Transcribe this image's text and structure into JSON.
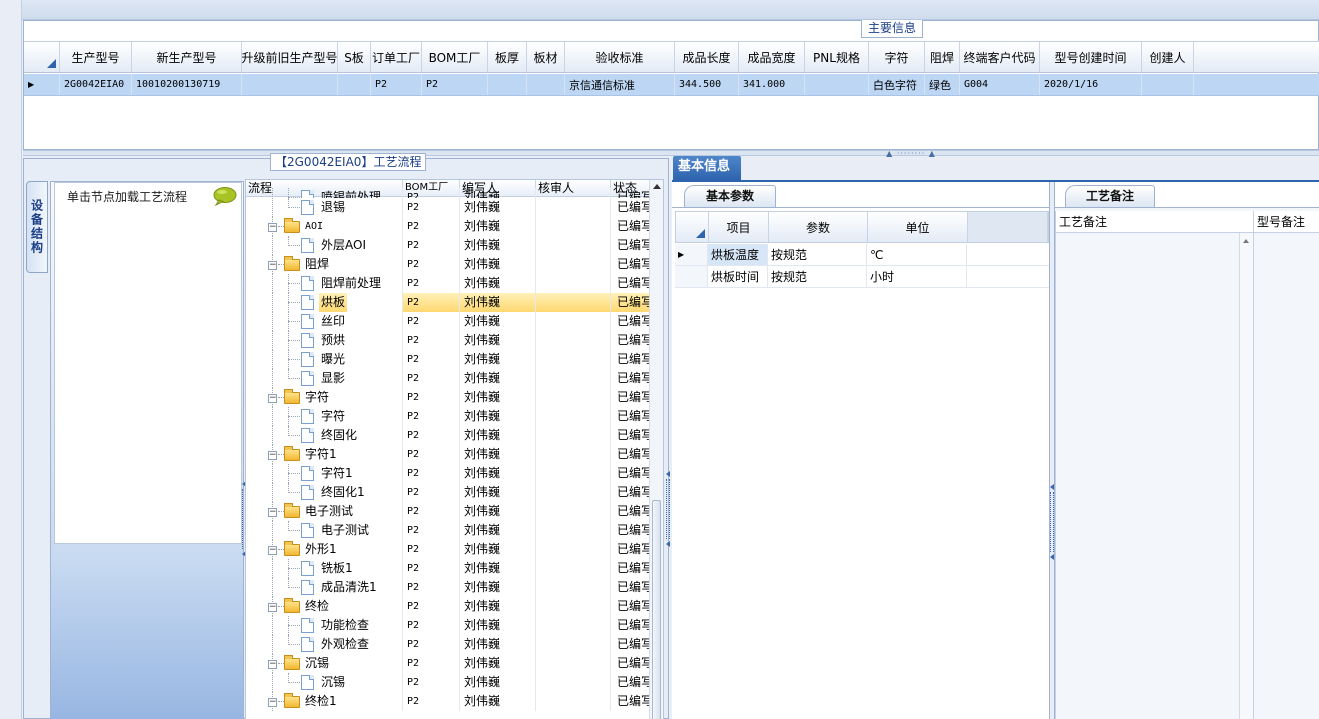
{
  "main_info": {
    "caption": "主要信息",
    "columns": [
      "生产型号",
      "新生产型号",
      "升级前旧生产型号",
      "S板",
      "订单工厂",
      "BOM工厂",
      "板厚",
      "板材",
      "验收标准",
      "成品长度",
      "成品宽度",
      "PNL规格",
      "字符",
      "阻焊",
      "终端客户代码",
      "型号创建时间",
      "创建人"
    ],
    "row": [
      "2G0042EIA0",
      "10010200130719",
      "",
      "",
      "P2",
      "P2",
      "",
      "",
      "京信通信标准",
      "344.500",
      "341.000",
      "",
      "白色字符",
      "绿色",
      "G004",
      "2020/1/16",
      ""
    ]
  },
  "left_panel": {
    "side_tab": "设备结构",
    "nav_title": "单击节点加载工艺流程",
    "nav_icon": "speech-bubble-icon"
  },
  "tree": {
    "caption": "【2G0042EIA0】工艺流程",
    "columns": [
      "流程",
      "BOM工厂",
      "编写人",
      "核审人",
      "状态"
    ],
    "rows": [
      {
        "level": 2,
        "kind": "file",
        "name": "喷锡前处理",
        "bom": "P2",
        "writer": "刘伟巍",
        "reviewer": "",
        "status": "已编写",
        "partial": true
      },
      {
        "level": 2,
        "kind": "file",
        "name": "退锡",
        "bom": "P2",
        "writer": "刘伟巍",
        "reviewer": "",
        "status": "已编写",
        "last": true
      },
      {
        "level": 1,
        "kind": "folder",
        "name": "AOI",
        "bom": "P2",
        "writer": "刘伟巍",
        "reviewer": "",
        "status": "已编写"
      },
      {
        "level": 2,
        "kind": "file",
        "name": "外层AOI",
        "bom": "P2",
        "writer": "刘伟巍",
        "reviewer": "",
        "status": "已编写",
        "last": true
      },
      {
        "level": 1,
        "kind": "folder",
        "name": "阻焊",
        "bom": "P2",
        "writer": "刘伟巍",
        "reviewer": "",
        "status": "已编写"
      },
      {
        "level": 2,
        "kind": "file",
        "name": "阻焊前处理",
        "bom": "P2",
        "writer": "刘伟巍",
        "reviewer": "",
        "status": "已编写"
      },
      {
        "level": 2,
        "kind": "file",
        "name": "烘板",
        "bom": "P2",
        "writer": "刘伟巍",
        "reviewer": "",
        "status": "已编写",
        "selected": true
      },
      {
        "level": 2,
        "kind": "file",
        "name": "丝印",
        "bom": "P2",
        "writer": "刘伟巍",
        "reviewer": "",
        "status": "已编写"
      },
      {
        "level": 2,
        "kind": "file",
        "name": "预烘",
        "bom": "P2",
        "writer": "刘伟巍",
        "reviewer": "",
        "status": "已编写"
      },
      {
        "level": 2,
        "kind": "file",
        "name": "曝光",
        "bom": "P2",
        "writer": "刘伟巍",
        "reviewer": "",
        "status": "已编写"
      },
      {
        "level": 2,
        "kind": "file",
        "name": "显影",
        "bom": "P2",
        "writer": "刘伟巍",
        "reviewer": "",
        "status": "已编写",
        "last": true
      },
      {
        "level": 1,
        "kind": "folder",
        "name": "字符",
        "bom": "P2",
        "writer": "刘伟巍",
        "reviewer": "",
        "status": "已编写"
      },
      {
        "level": 2,
        "kind": "file",
        "name": "字符",
        "bom": "P2",
        "writer": "刘伟巍",
        "reviewer": "",
        "status": "已编写"
      },
      {
        "level": 2,
        "kind": "file",
        "name": "终固化",
        "bom": "P2",
        "writer": "刘伟巍",
        "reviewer": "",
        "status": "已编写",
        "last": true
      },
      {
        "level": 1,
        "kind": "folder",
        "name": "字符1",
        "bom": "P2",
        "writer": "刘伟巍",
        "reviewer": "",
        "status": "已编写"
      },
      {
        "level": 2,
        "kind": "file",
        "name": "字符1",
        "bom": "P2",
        "writer": "刘伟巍",
        "reviewer": "",
        "status": "已编写"
      },
      {
        "level": 2,
        "kind": "file",
        "name": "终固化1",
        "bom": "P2",
        "writer": "刘伟巍",
        "reviewer": "",
        "status": "已编写",
        "last": true
      },
      {
        "level": 1,
        "kind": "folder",
        "name": "电子测试",
        "bom": "P2",
        "writer": "刘伟巍",
        "reviewer": "",
        "status": "已编写"
      },
      {
        "level": 2,
        "kind": "file",
        "name": "电子测试",
        "bom": "P2",
        "writer": "刘伟巍",
        "reviewer": "",
        "status": "已编写",
        "last": true
      },
      {
        "level": 1,
        "kind": "folder",
        "name": "外形1",
        "bom": "P2",
        "writer": "刘伟巍",
        "reviewer": "",
        "status": "已编写"
      },
      {
        "level": 2,
        "kind": "file",
        "name": "铣板1",
        "bom": "P2",
        "writer": "刘伟巍",
        "reviewer": "",
        "status": "已编写"
      },
      {
        "level": 2,
        "kind": "file",
        "name": "成品清洗1",
        "bom": "P2",
        "writer": "刘伟巍",
        "reviewer": "",
        "status": "已编写",
        "last": true
      },
      {
        "level": 1,
        "kind": "folder",
        "name": "终检",
        "bom": "P2",
        "writer": "刘伟巍",
        "reviewer": "",
        "status": "已编写"
      },
      {
        "level": 2,
        "kind": "file",
        "name": "功能检查",
        "bom": "P2",
        "writer": "刘伟巍",
        "reviewer": "",
        "status": "已编写"
      },
      {
        "level": 2,
        "kind": "file",
        "name": "外观检查",
        "bom": "P2",
        "writer": "刘伟巍",
        "reviewer": "",
        "status": "已编写",
        "last": true
      },
      {
        "level": 1,
        "kind": "folder",
        "name": "沉锡",
        "bom": "P2",
        "writer": "刘伟巍",
        "reviewer": "",
        "status": "已编写"
      },
      {
        "level": 2,
        "kind": "file",
        "name": "沉锡",
        "bom": "P2",
        "writer": "刘伟巍",
        "reviewer": "",
        "status": "已编写",
        "last": true
      },
      {
        "level": 1,
        "kind": "folder",
        "name": "终检1",
        "bom": "P2",
        "writer": "刘伟巍",
        "reviewer": "",
        "status": "已编写"
      }
    ]
  },
  "basic_info": {
    "tab": "基本信息",
    "params_tab": "基本参数",
    "params_columns": [
      "项目",
      "参数",
      "单位"
    ],
    "params_rows": [
      {
        "item": "烘板温度",
        "param": "按规范",
        "unit": "℃"
      },
      {
        "item": "烘板时间",
        "param": "按规范",
        "unit": "小时"
      }
    ],
    "notes_tab": "工艺备注",
    "notes_columns": [
      "工艺备注",
      "型号备注"
    ]
  }
}
